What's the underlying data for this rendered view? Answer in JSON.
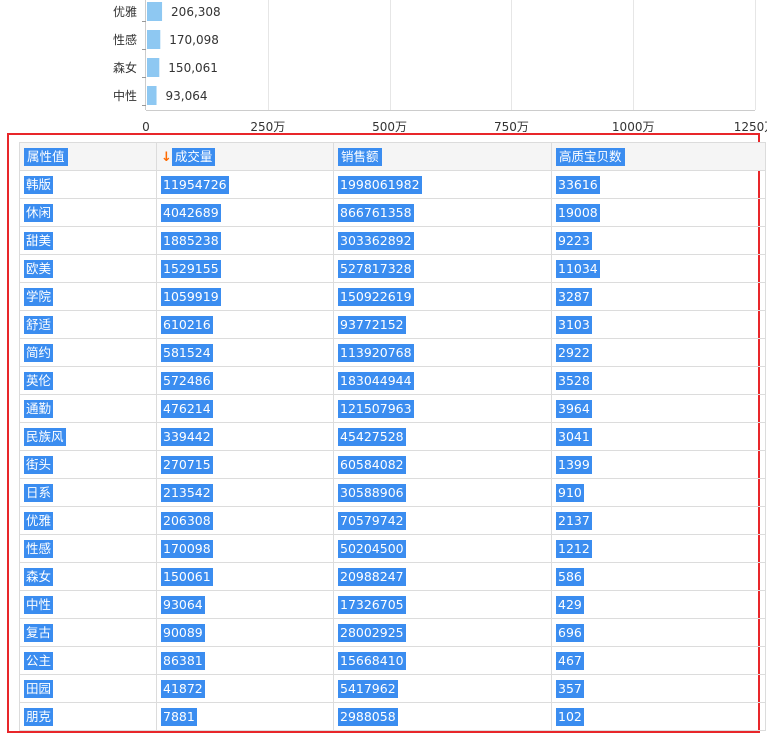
{
  "chart_data": {
    "type": "bar",
    "orientation": "horizontal",
    "categories": [
      "优雅",
      "性感",
      "森女",
      "中性"
    ],
    "values": [
      206308,
      170098,
      150061,
      93064
    ],
    "value_labels": [
      "206,308",
      "170,098",
      "150,061",
      "93,064"
    ],
    "xlim": [
      0,
      12500000
    ],
    "x_ticks": [
      0,
      2500000,
      5000000,
      7500000,
      10000000,
      12500000
    ],
    "x_tick_labels": [
      "0",
      "250万",
      "500万",
      "750万",
      "1000万",
      "1250万"
    ],
    "grid": true,
    "bar_color": "#8ec8f2"
  },
  "table": {
    "headers": [
      "属性值",
      "成交量",
      "销售额",
      "高质宝贝数"
    ],
    "sort_arrow": "↓",
    "rows": [
      [
        "韩版",
        "11954726",
        "1998061982",
        "33616"
      ],
      [
        "休闲",
        "4042689",
        "866761358",
        "19008"
      ],
      [
        "甜美",
        "1885238",
        "303362892",
        "9223"
      ],
      [
        "欧美",
        "1529155",
        "527817328",
        "11034"
      ],
      [
        "学院",
        "1059919",
        "150922619",
        "3287"
      ],
      [
        "舒适",
        "610216",
        "93772152",
        "3103"
      ],
      [
        "简约",
        "581524",
        "113920768",
        "2922"
      ],
      [
        "英伦",
        "572486",
        "183044944",
        "3528"
      ],
      [
        "通勤",
        "476214",
        "121507963",
        "3964"
      ],
      [
        "民族风",
        "339442",
        "45427528",
        "3041"
      ],
      [
        "街头",
        "270715",
        "60584082",
        "1399"
      ],
      [
        "日系",
        "213542",
        "30588906",
        "910"
      ],
      [
        "优雅",
        "206308",
        "70579742",
        "2137"
      ],
      [
        "性感",
        "170098",
        "50204500",
        "1212"
      ],
      [
        "森女",
        "150061",
        "20988247",
        "586"
      ],
      [
        "中性",
        "93064",
        "17326705",
        "429"
      ],
      [
        "复古",
        "90089",
        "28002925",
        "696"
      ],
      [
        "公主",
        "86381",
        "15668410",
        "467"
      ],
      [
        "田园",
        "41872",
        "5417962",
        "357"
      ],
      [
        "朋克",
        "7881",
        "2988058",
        "102"
      ]
    ]
  },
  "colors": {
    "selection": "#3b8df0",
    "highlight_border": "#e8262a",
    "sort_arrow": "#ff6a00"
  }
}
